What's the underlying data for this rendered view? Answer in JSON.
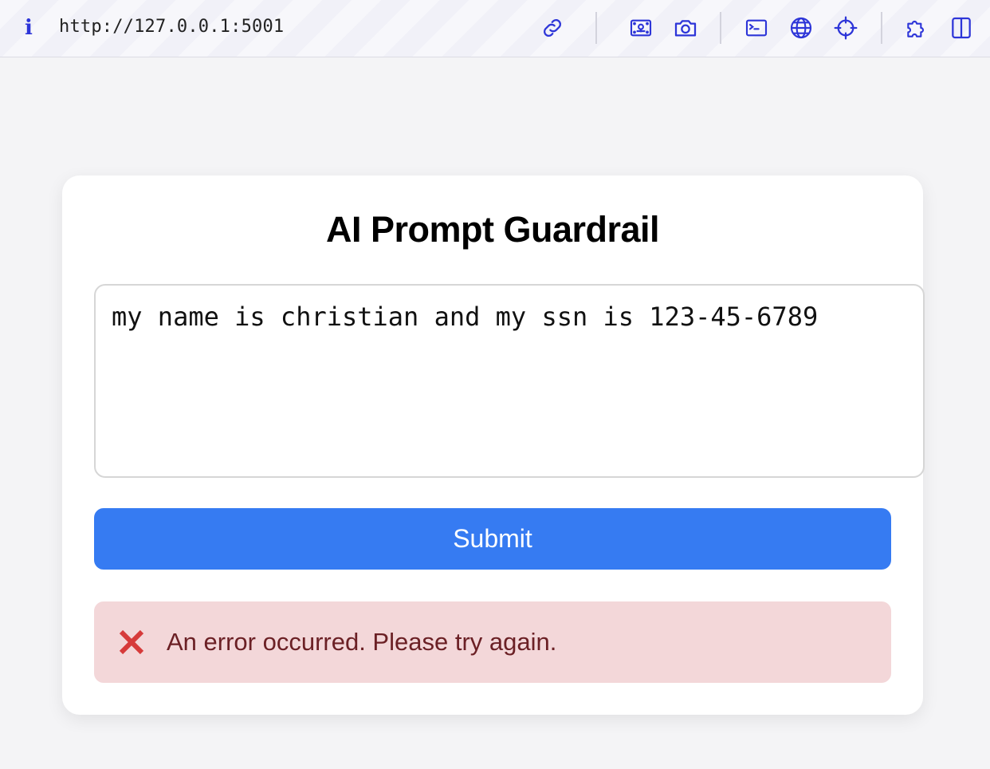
{
  "browser": {
    "url": "http://127.0.0.1:5001",
    "info_icon": "i",
    "toolbar_icons": [
      "link-icon",
      "image-icon",
      "camera-icon",
      "terminal-icon",
      "globe-icon",
      "crosshair-icon",
      "puzzle-icon",
      "sidebar-icon"
    ],
    "icon_color": "#2d35d8"
  },
  "card": {
    "title": "AI Prompt Guardrail",
    "prompt_value": "my name is christian and my ssn is 123-45-6789",
    "submit_label": "Submit",
    "error_icon": "x-icon",
    "error_message": "An error occurred. Please try again.",
    "colors": {
      "submit": "#367bf2",
      "error_bg": "#f3d7d9",
      "error_text": "#6b2025",
      "error_icon": "#d63a3a"
    }
  }
}
